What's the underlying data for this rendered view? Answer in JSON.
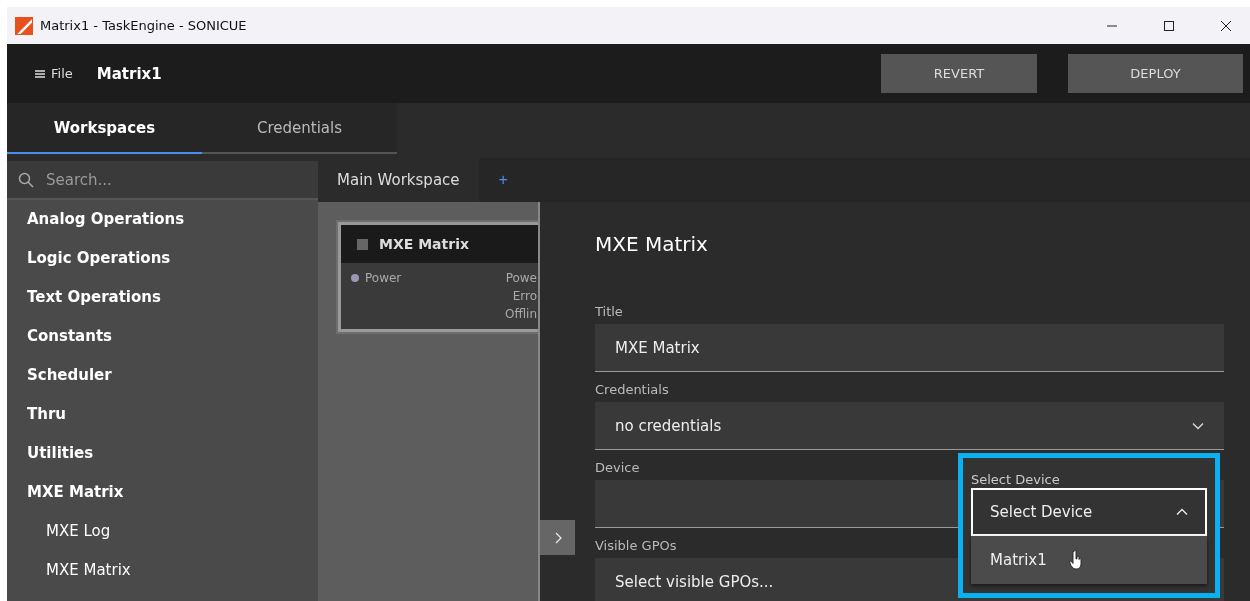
{
  "window": {
    "title": "Matrix1 - TaskEngine - SONICUE"
  },
  "menu": {
    "label": "File"
  },
  "project": "Matrix1",
  "actions": [
    "REVERT",
    "DEPLOY"
  ],
  "tabs": [
    {
      "label": "Workspaces",
      "selected": true
    },
    {
      "label": "Credentials",
      "selected": false
    }
  ],
  "search": {
    "placeholder": "Search..."
  },
  "sidebar": {
    "items": [
      {
        "label": "Analog Operations"
      },
      {
        "label": "Logic Operations"
      },
      {
        "label": "Text Operations"
      },
      {
        "label": "Constants"
      },
      {
        "label": "Scheduler"
      },
      {
        "label": "Thru"
      },
      {
        "label": "Utilities"
      },
      {
        "label": "MXE Matrix",
        "children": [
          {
            "label": "MXE Log"
          },
          {
            "label": "MXE Matrix"
          }
        ]
      }
    ]
  },
  "workspace_tabs": [
    {
      "label": "Main Workspace",
      "selected": true
    }
  ],
  "add_tab": "+",
  "node": {
    "title": "MXE Matrix",
    "inputs": [
      "Power"
    ],
    "outputs": [
      "Powe",
      "Erro",
      "Offlin"
    ]
  },
  "panel": {
    "title": "MXE Matrix",
    "fields": [
      {
        "label": "Title",
        "kind": "text",
        "value": "MXE Matrix"
      },
      {
        "label": "Credentials",
        "kind": "select",
        "value": "no credentials"
      },
      {
        "label": "Device",
        "kind": "picker"
      },
      {
        "label": "Visible GPOs",
        "kind": "picker",
        "placeholder": "Select visible GPOs..."
      }
    ]
  },
  "dropdown": {
    "label": "Select Device",
    "value": "Select Device",
    "expanded": true,
    "options": [
      {
        "label": "Matrix1",
        "hovered": true
      }
    ]
  }
}
